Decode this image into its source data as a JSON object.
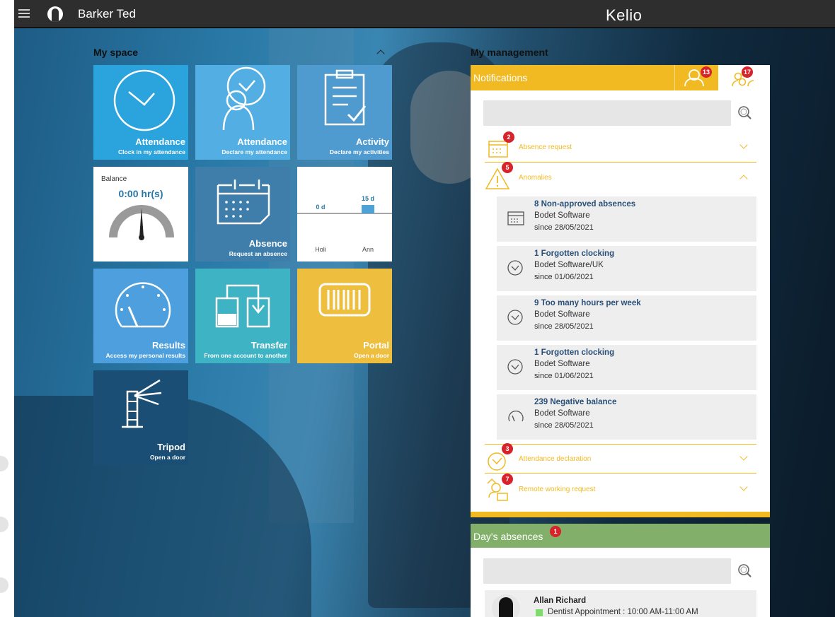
{
  "header": {
    "user_name": "Barker Ted",
    "brand": "Kelio"
  },
  "my_space": {
    "title": "My space",
    "tiles": {
      "attendance_clock": {
        "title": "Attendance",
        "subtitle": "Clock in my attendance",
        "color": "#2ba3dc"
      },
      "attendance_declare": {
        "title": "Attendance",
        "subtitle": "Declare my attendance",
        "color": "#52aee3"
      },
      "activity": {
        "title": "Activity",
        "subtitle": "Declare my activities",
        "color": "#4f9bd0"
      },
      "balance": {
        "label": "Balance",
        "value": "0:00 hr(s)"
      },
      "absence": {
        "title": "Absence",
        "subtitle": "Request an absence",
        "color": "#3f7eaa"
      },
      "holiday_chart": {
        "type": "bar",
        "categories": [
          "Holi",
          "Ann"
        ],
        "values": [
          0,
          15
        ],
        "value_labels": [
          "0 d",
          "15 d"
        ],
        "bar_color": "#4ea2d8"
      },
      "results": {
        "title": "Results",
        "subtitle": "Access my personal results",
        "color": "#4da0dd"
      },
      "transfer": {
        "title": "Transfer",
        "subtitle": "From one account to another",
        "color": "#3db3c3"
      },
      "portal": {
        "title": "Portal",
        "subtitle": "Open a door",
        "color": "#eebe3f"
      },
      "tripod": {
        "title": "Tripod",
        "subtitle": "Open a door",
        "color": "#1a4e74"
      }
    }
  },
  "my_management": {
    "title": "My management",
    "notifications": {
      "title": "Notifications",
      "tab_personal_count": "13",
      "tab_team_count": "17",
      "search_placeholder": "",
      "categories": [
        {
          "label": "Absence request",
          "count": "2"
        },
        {
          "label": "Anomalies",
          "count": "5"
        },
        {
          "label": "Attendance declaration",
          "count": "3"
        },
        {
          "label": "Remote working request",
          "count": "7"
        }
      ],
      "anomalies": [
        {
          "title": "8 Non-approved absences",
          "org": "Bodet Software",
          "since": "since 28/05/2021",
          "icon": "calendar-icon"
        },
        {
          "title": "1 Forgotten clocking",
          "org": "Bodet Software/UK",
          "since": "since 01/06/2021",
          "icon": "clock-icon"
        },
        {
          "title": "9 Too many hours per week",
          "org": "Bodet Software",
          "since": "since 28/05/2021",
          "icon": "clock-icon"
        },
        {
          "title": "1 Forgotten clocking",
          "org": "Bodet Software",
          "since": "since 01/06/2021",
          "icon": "clock-icon"
        },
        {
          "title": "239 Negative balance",
          "org": "Bodet Software",
          "since": "since 28/05/2021",
          "icon": "gauge-icon"
        }
      ]
    },
    "days_absences": {
      "title": "Day's absences",
      "count": "1",
      "search_placeholder": "",
      "items": [
        {
          "name": "Allan Richard",
          "reason": "Dentist Appointment : 10:00 AM-11:00 AM"
        }
      ]
    }
  },
  "colors": {
    "notification_yellow": "#f1ba23",
    "absences_green": "#82b06a",
    "badge_red": "#d8232a",
    "link_blue": "#2a4f77"
  }
}
